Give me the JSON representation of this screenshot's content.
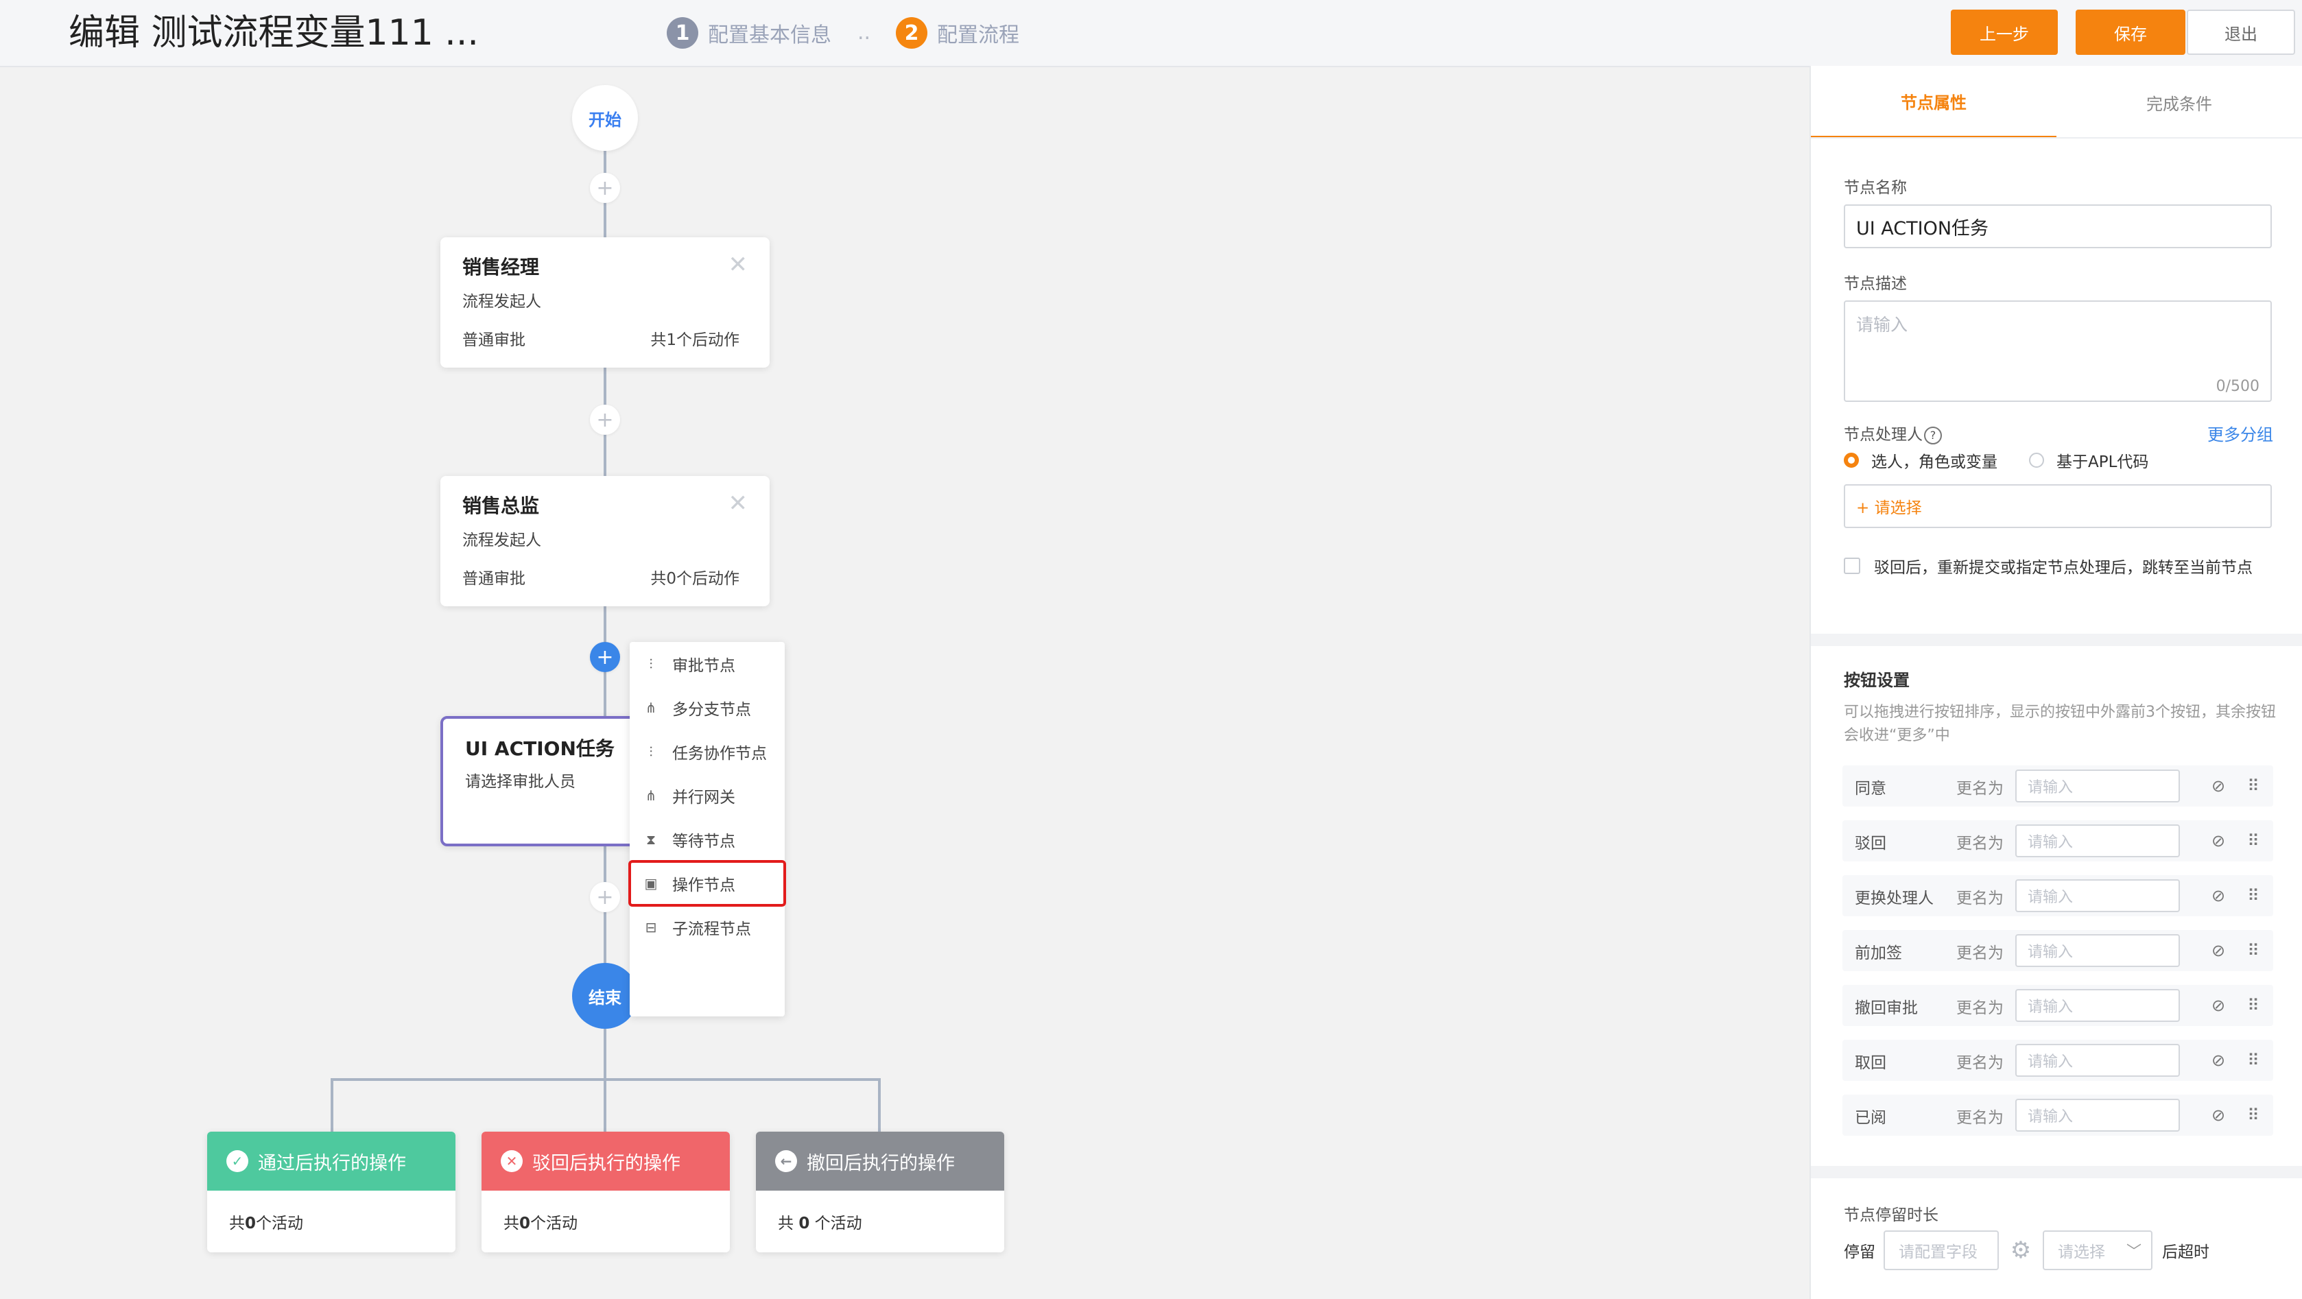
{
  "header": {
    "title": "编辑 测试流程变量111 ...",
    "step1_num": "1",
    "step1_label": "配置基本信息",
    "step_dots": "..",
    "step2_num": "2",
    "step2_label": "配置流程",
    "btn_prev": "上一步",
    "btn_save": "保存",
    "btn_exit": "退出"
  },
  "flow": {
    "start_label": "开始",
    "end_label": "结束",
    "plus": "+",
    "nodes": [
      {
        "title": "销售经理",
        "subtitle": "流程发起人",
        "type": "普通审批",
        "actions": "共1个后动作"
      },
      {
        "title": "销售总监",
        "subtitle": "流程发起人",
        "type": "普通审批",
        "actions": "共0个后动作"
      },
      {
        "title": "UI ACTION任务",
        "subtitle": "请选择审批人员"
      }
    ],
    "close_glyph": "✕",
    "menu": [
      {
        "label": "审批节点",
        "icon": "approval-node-icon"
      },
      {
        "label": "多分支节点",
        "icon": "multi-branch-icon"
      },
      {
        "label": "任务协作节点",
        "icon": "task-collab-icon"
      },
      {
        "label": "并行网关",
        "icon": "parallel-gateway-icon"
      },
      {
        "label": "等待节点",
        "icon": "hourglass-icon"
      },
      {
        "label": "操作节点",
        "icon": "ui-action-icon"
      },
      {
        "label": "子流程节点",
        "icon": "subprocess-icon"
      }
    ],
    "results": [
      {
        "title": "通过后执行的操作",
        "prefix": "共",
        "count": "0",
        "suffix": "个活动",
        "color": "#4ec99e",
        "icon": "check-circle-icon"
      },
      {
        "title": "驳回后执行的操作",
        "prefix": "共",
        "count": "0",
        "suffix": "个活动",
        "color": "#f0666a",
        "icon": "x-circle-icon"
      },
      {
        "title": "撤回后执行的操作",
        "prefix": "共 ",
        "count": "0",
        "suffix": " 个活动",
        "color": "#8a8d93",
        "icon": "back-circle-icon"
      }
    ]
  },
  "panel": {
    "tab_props": "节点属性",
    "tab_complete": "完成条件",
    "name_label": "节点名称",
    "name_value": "UI ACTION任务",
    "desc_label": "节点描述",
    "desc_placeholder": "请输入",
    "desc_counter": "0/500",
    "handler_label": "节点处理人",
    "handler_help": "?",
    "more_groups": "更多分组",
    "radio1": "选人，角色或变量",
    "radio2": "基于APL代码",
    "select_placeholder": "+ 请选择",
    "checkbox_label": "驳回后，重新提交或指定节点处理后，跳转至当前节点",
    "btn_settings_title": "按钮设置",
    "btn_settings_hint": "可以拖拽进行按钮排序，显示的按钮中外露前3个按钮，其余按钮会收进“更多”中",
    "rename_label": "更名为",
    "rename_placeholder": "请输入",
    "buttons": [
      "同意",
      "驳回",
      "更换处理人",
      "前加签",
      "撤回审批",
      "取回",
      "已阅"
    ],
    "stay_title": "节点停留时长",
    "stay_label": "停留",
    "stay_field_placeholder": "请配置字段",
    "stay_select_placeholder": "请选择",
    "stay_suffix": "后超时"
  }
}
